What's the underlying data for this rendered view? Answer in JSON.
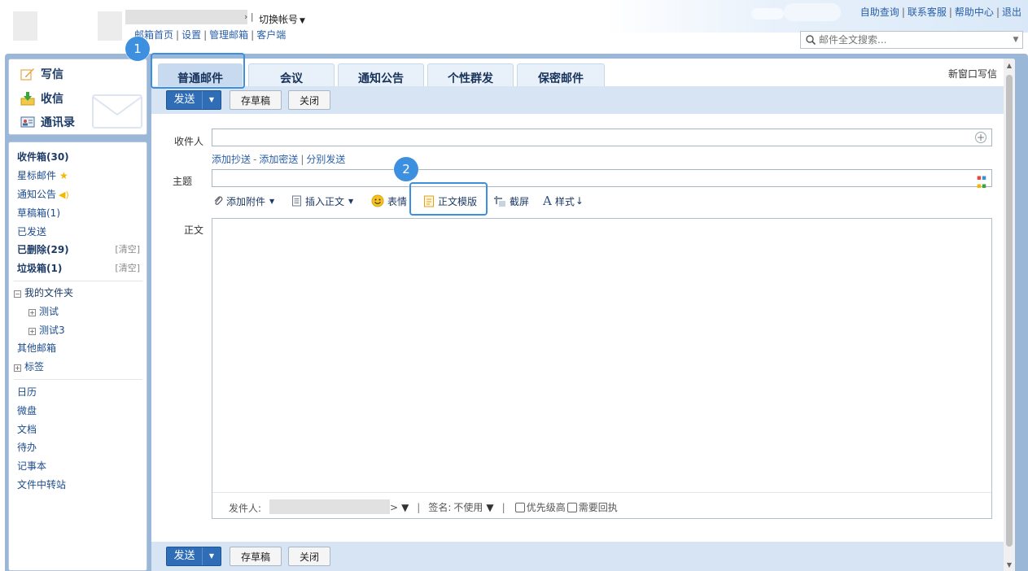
{
  "header": {
    "switch_account": "切换帐号",
    "top_links": [
      "邮箱首页",
      "设置",
      "管理邮箱",
      "客户端"
    ],
    "right_links": [
      "自助查询",
      "联系客服",
      "帮助中心",
      "退出"
    ],
    "search_placeholder": "邮件全文搜索..."
  },
  "sidebar": {
    "compose": "写信",
    "receive": "收信",
    "contacts": "通讯录",
    "folders": {
      "inbox": "收件箱(30)",
      "starred": "星标邮件",
      "notices": "通知公告",
      "drafts": "草稿箱(1)",
      "sent": "已发送",
      "deleted": "已删除(29)",
      "spam": "垃圾箱(1)",
      "clear_label": "[清空]"
    },
    "my_folders": "我的文件夹",
    "sub_folders": [
      "测试",
      "测试3"
    ],
    "other_mailbox": "其他邮箱",
    "tags": "标签",
    "apps": [
      "日历",
      "微盘",
      "文档",
      "待办",
      "记事本",
      "文件中转站"
    ]
  },
  "tabs": [
    "普通邮件",
    "会议",
    "通知公告",
    "个性群发",
    "保密邮件"
  ],
  "new_window_compose": "新窗口写信",
  "toolbar": {
    "send": "发送",
    "save_draft": "存草稿",
    "close": "关闭"
  },
  "form": {
    "recipient_label": "收件人",
    "cc_links": {
      "add_cc": "添加抄送",
      "add_bcc": "添加密送",
      "separate": "分别发送"
    },
    "subject_label": "主题",
    "body_label": "正文"
  },
  "format_toolbar": {
    "attach": "添加附件",
    "insert_body": "插入正文",
    "emoji": "表情",
    "template": "正文模版",
    "screenshot": "截屏",
    "style": "样式"
  },
  "footer": {
    "sender_label": "发件人:",
    "signature_label": "签名:",
    "signature_value": "不使用",
    "high_priority": "优先级高",
    "read_receipt": "需要回执"
  },
  "annotations": {
    "marker1": "1",
    "marker2": "2"
  },
  "colors": {
    "accent": "#2f6eb7",
    "frame": "#9ab7d8",
    "toolbar_bg": "#d6e4f4",
    "marker": "#3d8fe0"
  }
}
